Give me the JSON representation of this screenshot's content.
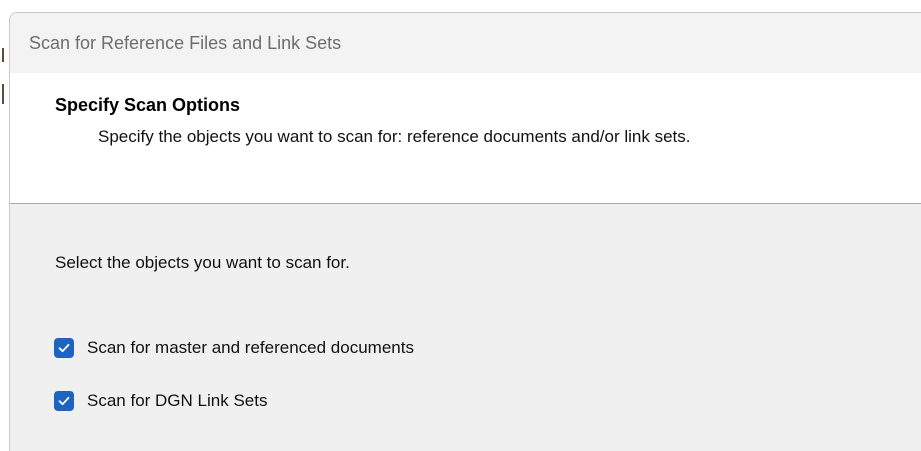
{
  "window": {
    "title": "Scan for Reference Files and Link Sets"
  },
  "header": {
    "title": "Specify Scan Options",
    "subtitle": "Specify the objects you want to scan for: reference documents and/or link sets."
  },
  "body": {
    "instruction": "Select the objects you want to scan for.",
    "options": [
      {
        "label": "Scan for master and referenced documents",
        "checked": true
      },
      {
        "label": "Scan for DGN Link Sets",
        "checked": true
      }
    ]
  },
  "colors": {
    "checkbox_accent": "#1d63c0",
    "panel_background": "#f0f0f0",
    "header_background": "#ffffff"
  },
  "icons": {
    "checkbox_checked": "checkmark-icon"
  }
}
